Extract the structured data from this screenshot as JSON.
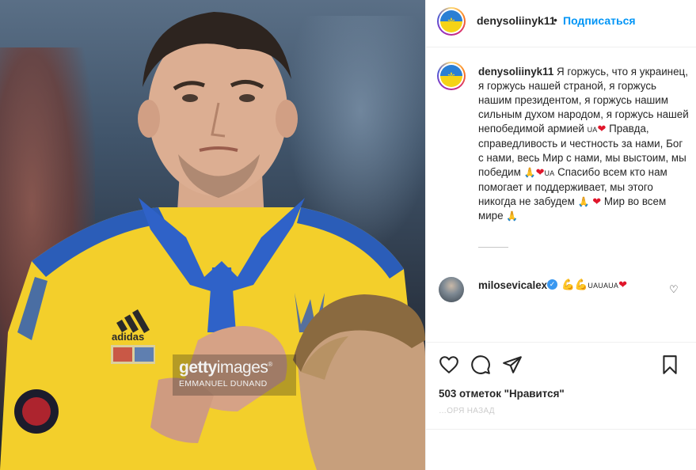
{
  "photo": {
    "watermark_brand_a": "getty",
    "watermark_brand_b": "images",
    "watermark_trademark": "®",
    "watermark_credit": "EMMANUEL DUNAND",
    "jersey_brand": "adidas"
  },
  "header": {
    "username": "denysoliinyk11",
    "separator": "•",
    "follow_label": "Подписаться"
  },
  "caption": {
    "username": "denysoliinyk11",
    "part1": "Я горжусь, что я украинец, я горжусь нашей страной, я горжусь нашим президентом, я горжусь нашим сильным духом народом, я горжусь нашей непобедимой армией",
    "ua1": "UA",
    "heart": "❤",
    "part2": "Правда, справедливость и честность за нами, Бог с нами, весь Мир с нами, мы выстоим, мы победим",
    "pray": "🙏",
    "ua2": "UA",
    "part3": "Спасибо всем кто нам помогает и поддерживает, мы этого никогда не забудем",
    "part4": "Мир во всем мире"
  },
  "comment": {
    "username": "milosevicalex",
    "verified_mark": "✓",
    "arm_emoji": "💪",
    "ua_text": "UAUAUA",
    "heart": "❤",
    "like_icon": "heart-outline-icon",
    "like_glyph": "♡"
  },
  "actions": {
    "like_icon": "heart-outline-icon",
    "comment_icon": "comment-bubble-icon",
    "share_icon": "paper-plane-icon",
    "save_icon": "bookmark-icon"
  },
  "likes_text": "503 отметок \"Нравится\"",
  "time_ago": "…ОРЯ НАЗАД",
  "colors": {
    "follow_blue": "#0095f6",
    "heart_red": "#e0162b",
    "jersey_yellow": "#f3cf2b",
    "jersey_blue": "#2b5db8",
    "verified_blue": "#3897f0"
  }
}
